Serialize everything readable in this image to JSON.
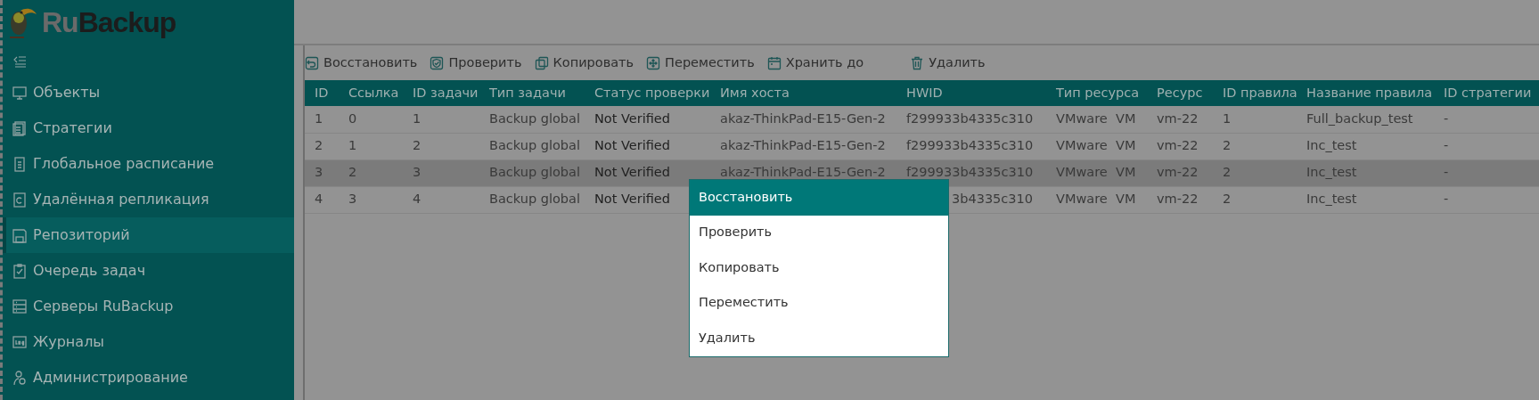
{
  "logo": {
    "parts": [
      "Ru",
      "Backup"
    ]
  },
  "sidebar": {
    "items": [
      {
        "label": "Объекты",
        "selected": false
      },
      {
        "label": "Стратегии",
        "selected": false
      },
      {
        "label": "Глобальное расписание",
        "selected": false
      },
      {
        "label": "Удалённая репликация",
        "selected": false
      },
      {
        "label": "Репозиторий",
        "selected": true
      },
      {
        "label": "Очередь задач",
        "selected": false
      },
      {
        "label": "Серверы RuBackup",
        "selected": false
      },
      {
        "label": "Журналы",
        "selected": false
      },
      {
        "label": "Администрирование",
        "selected": false
      }
    ]
  },
  "toolbar": [
    "Восстановить",
    "Проверить",
    "Копировать",
    "Переместить",
    "Хранить до",
    "Удалить"
  ],
  "table": {
    "columns": [
      "ID",
      "Ссылка",
      "ID задачи",
      "Тип задачи",
      "Статус проверки",
      "Имя хоста",
      "HWID",
      "Тип ресурса",
      "Ресурс",
      "ID правила",
      "Название правила",
      "ID стратегии"
    ],
    "rows": [
      {
        "selected": false,
        "cells": [
          "1",
          "0",
          "1",
          "Backup global",
          "Not Verified",
          "akaz-ThinkPad-E15-Gen-2",
          "f299933b4335c310",
          "VMware  VM",
          "vm-22",
          "1",
          "Full_backup_test",
          "-"
        ]
      },
      {
        "selected": false,
        "cells": [
          "2",
          "1",
          "2",
          "Backup global",
          "Not Verified",
          "akaz-ThinkPad-E15-Gen-2",
          "f299933b4335c310",
          "VMware  VM",
          "vm-22",
          "2",
          "Inc_test",
          "-"
        ]
      },
      {
        "selected": true,
        "cells": [
          "3",
          "2",
          "3",
          "Backup global",
          "Not Verified",
          "akaz-ThinkPad-E15-Gen-2",
          "f299933b4335c310",
          "VMware  VM",
          "vm-22",
          "2",
          "Inc_test",
          "-"
        ]
      },
      {
        "selected": false,
        "cells": [
          "4",
          "3",
          "4",
          "Backup global",
          "Not Verified",
          null,
          "3b4335c310",
          "VMware  VM",
          "vm-22",
          "2",
          "Inc_test",
          "-"
        ]
      }
    ]
  },
  "context_menu": [
    {
      "label": "Восстановить",
      "selected": true
    },
    {
      "label": "Проверить",
      "selected": false
    },
    {
      "label": "Копировать",
      "selected": false
    },
    {
      "label": "Переместить",
      "selected": false
    },
    {
      "label": "Удалить",
      "selected": false
    }
  ]
}
